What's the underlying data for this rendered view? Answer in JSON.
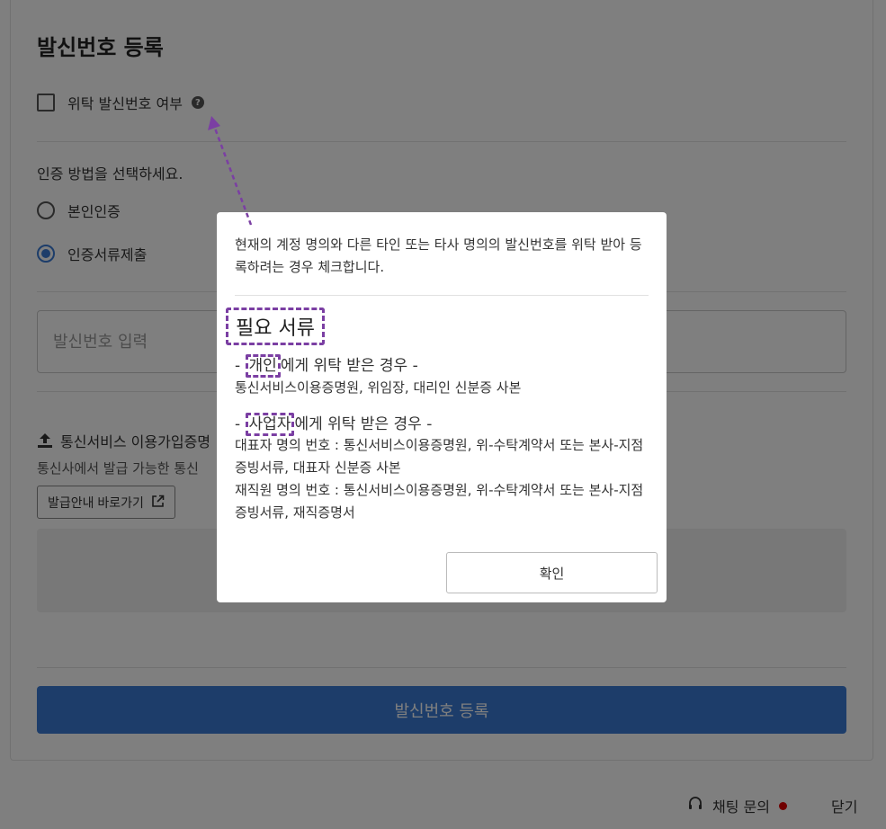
{
  "page": {
    "title": "발신번호 등록",
    "consign_checkbox_label": "위탁 발신번호 여부",
    "auth_prompt": "인증 방법을 선택하세요.",
    "auth_options": [
      "본인인증",
      "인증서류제출"
    ],
    "selected_auth_option": "인증서류제출",
    "phone_placeholder": "발신번호 입력",
    "upload_title": "통신서비스 이용가입증명",
    "upload_desc": "통신사에서 발급 가능한 통신",
    "guide_button_label": "발급안내 바로가기",
    "submit_label": "발신번호 등록"
  },
  "footer": {
    "chat_label": "채팅 문의",
    "close_label": "닫기"
  },
  "modal": {
    "description": "현재의 계정 명의와 다른 타인 또는 타사 명의의 발신번호를 위탁 받아 등록하려는 경우 체크합니다.",
    "required_docs_title": "필요 서류",
    "individual": {
      "prefix": "- ",
      "highlight": "개인",
      "suffix": "에게 위탁 받은 경우 -",
      "docs": "통신서비스이용증명원, 위임장, 대리인 신분증 사본"
    },
    "business": {
      "prefix": "- ",
      "highlight": "사업자",
      "suffix": "에게 위탁 받은 경우 -",
      "docs_ceo": "대표자 명의 번호 : 통신서비스이용증명원, 위-수탁계약서 또는 본사-지점 증빙서류, 대표자 신분증 사본",
      "docs_employee": "재직원 명의 번호 : 통신서비스이용증명원, 위-수탁계약서 또는 본사-지점 증빙서류, 재직증명서"
    },
    "confirm_label": "확인"
  },
  "colors": {
    "primary": "#3a7bd5",
    "annotation": "#7b3fa3",
    "status_dot": "#e00000"
  }
}
